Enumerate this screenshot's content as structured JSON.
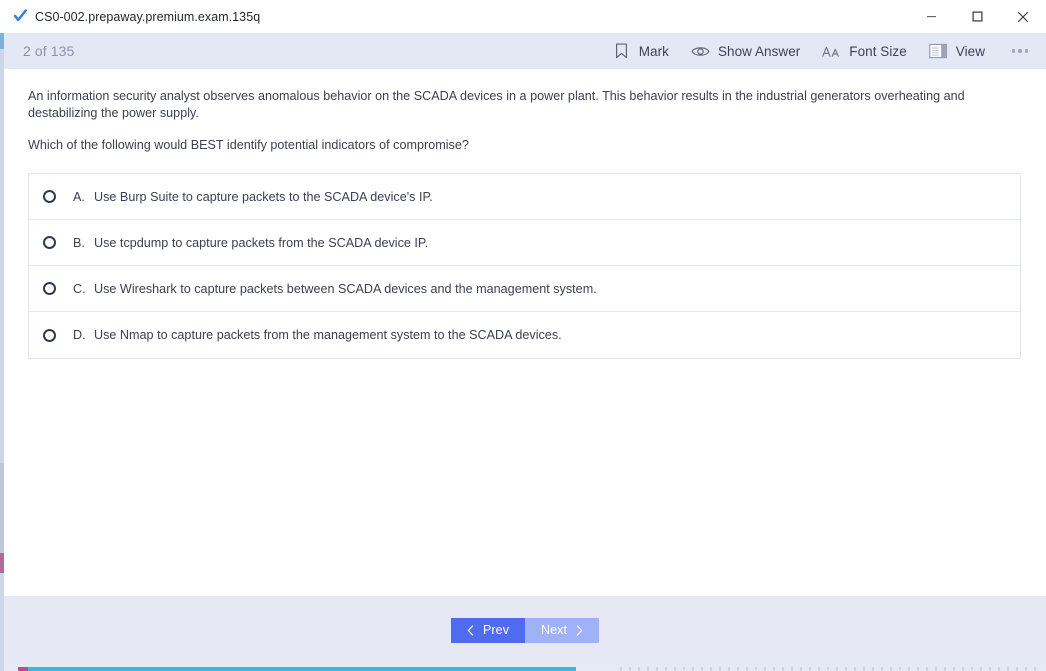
{
  "window": {
    "title": "CS0-002.prepaway.premium.exam.135q",
    "app_icon": "blue-check-icon",
    "controls": {
      "minimize_label": "Minimize",
      "maximize_label": "Maximize",
      "close_label": "Close"
    }
  },
  "toolbar": {
    "counter": "2 of 135",
    "buttons": [
      {
        "label": "Mark",
        "icon": "bookmark-icon"
      },
      {
        "label": "Show Answer",
        "icon": "eye-icon"
      },
      {
        "label": "Font Size",
        "icon": "font-size-icon"
      },
      {
        "label": "View",
        "icon": "view-panel-icon"
      }
    ],
    "more_label": "More options",
    "more_icon": "ellipsis-icon"
  },
  "question": {
    "stem": "An information security analyst observes anomalous behavior on the SCADA devices in a power plant. This behavior results in the industrial generators overheating and destabilizing the power supply.",
    "ask": "Which of the following would BEST identify potential indicators of compromise?",
    "options": [
      {
        "letter": "A.",
        "text": "Use Burp Suite to capture packets to the SCADA device's IP.",
        "selected": false
      },
      {
        "letter": "B.",
        "text": "Use tcpdump to capture packets from the SCADA device IP.",
        "selected": false
      },
      {
        "letter": "C.",
        "text": "Use Wireshark to capture packets between SCADA devices and the management system.",
        "selected": false
      },
      {
        "letter": "D.",
        "text": "Use Nmap to capture packets from the management system to the SCADA devices.",
        "selected": false
      }
    ]
  },
  "footer": {
    "prev_label": "Prev",
    "next_label": "Next",
    "prev_icon": "chevron-left-icon",
    "next_icon": "chevron-right-icon"
  },
  "colors": {
    "toolbar_bg": "#e3e8f5",
    "footer_bg": "#e6e9f4",
    "prev_button": "#4f6bf0",
    "next_button": "#9fb2f7",
    "text": "#3a3f55",
    "counter_text": "#8a93ab",
    "answer_border": "#dfe3ef"
  }
}
